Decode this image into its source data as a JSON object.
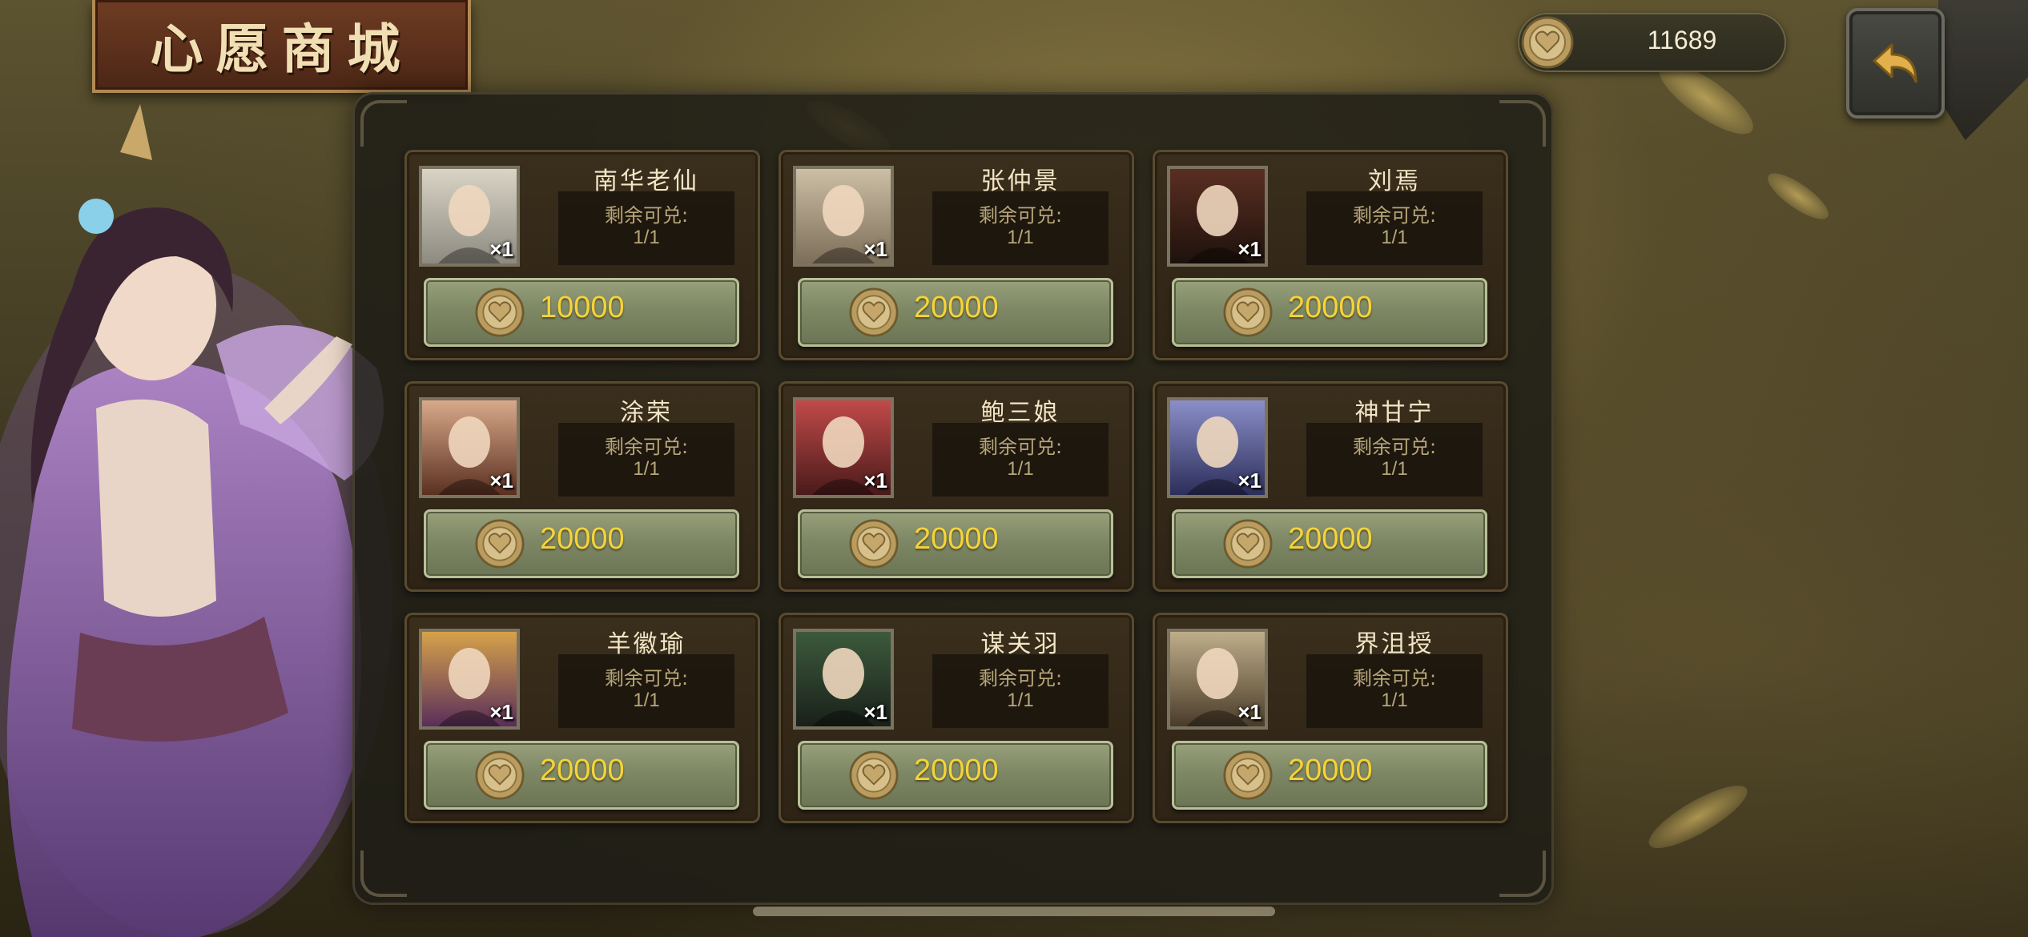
{
  "title": "心愿商城",
  "currency": {
    "icon": "heart-coin-icon",
    "balance": "11689"
  },
  "back_icon": "back-arrow-icon",
  "colors": {
    "price": "#f5d33a",
    "button": "#7e8865",
    "card": "#3a2e1c",
    "title_banner": "#5a2f1b"
  },
  "items": [
    {
      "name": "南华老仙",
      "remain_label": "剩余可兑:",
      "remain": "1/1",
      "qty": "×1",
      "price": "10000"
    },
    {
      "name": "张仲景",
      "remain_label": "剩余可兑:",
      "remain": "1/1",
      "qty": "×1",
      "price": "20000"
    },
    {
      "name": "刘焉",
      "remain_label": "剩余可兑:",
      "remain": "1/1",
      "qty": "×1",
      "price": "20000"
    },
    {
      "name": "涂荣",
      "remain_label": "剩余可兑:",
      "remain": "1/1",
      "qty": "×1",
      "price": "20000"
    },
    {
      "name": "鲍三娘",
      "remain_label": "剩余可兑:",
      "remain": "1/1",
      "qty": "×1",
      "price": "20000"
    },
    {
      "name": "神甘宁",
      "remain_label": "剩余可兑:",
      "remain": "1/1",
      "qty": "×1",
      "price": "20000"
    },
    {
      "name": "羊徽瑜",
      "remain_label": "剩余可兑:",
      "remain": "1/1",
      "qty": "×1",
      "price": "20000"
    },
    {
      "name": "谋关羽",
      "remain_label": "剩余可兑:",
      "remain": "1/1",
      "qty": "×1",
      "price": "20000"
    },
    {
      "name": "界沮授",
      "remain_label": "剩余可兑:",
      "remain": "1/1",
      "qty": "×1",
      "price": "20000"
    }
  ]
}
